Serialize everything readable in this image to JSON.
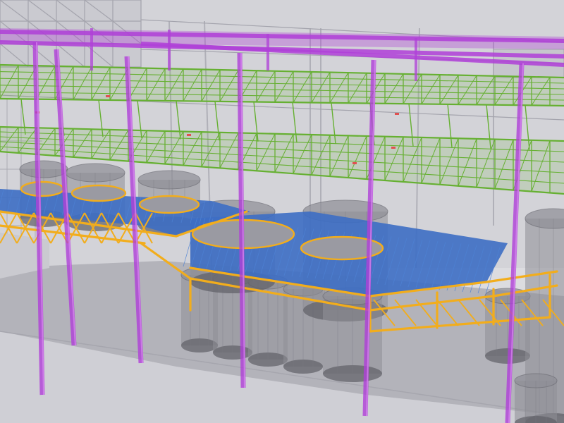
{
  "viewport": {
    "description_hidden": "",
    "colors": {
      "background": "#dcdce0",
      "ghost_structure": "#9a9aa4",
      "ghost_fill": "#b9b9c2",
      "tank": "#8e8e96",
      "tank_dark": "#5f5f66",
      "floor": "#b6b6bd",
      "purple_columns": "#b040d8",
      "green_truss": "#66b032",
      "orange_steel": "#f2ad1c",
      "blue_deck": "#3d6ec4",
      "deck_grating": "#4e82d4",
      "red_accent": "#e05050"
    },
    "layers": [
      {
        "name": "ghost-building",
        "color_key": "ghost_structure"
      },
      {
        "name": "storage-tanks",
        "color_key": "tank"
      },
      {
        "name": "main-pipe-columns",
        "color_key": "purple_columns"
      },
      {
        "name": "upper-pipe-rack",
        "color_key": "green_truss"
      },
      {
        "name": "platform-framing",
        "color_key": "orange_steel"
      },
      {
        "name": "platform-deck",
        "color_key": "blue_deck"
      }
    ]
  }
}
